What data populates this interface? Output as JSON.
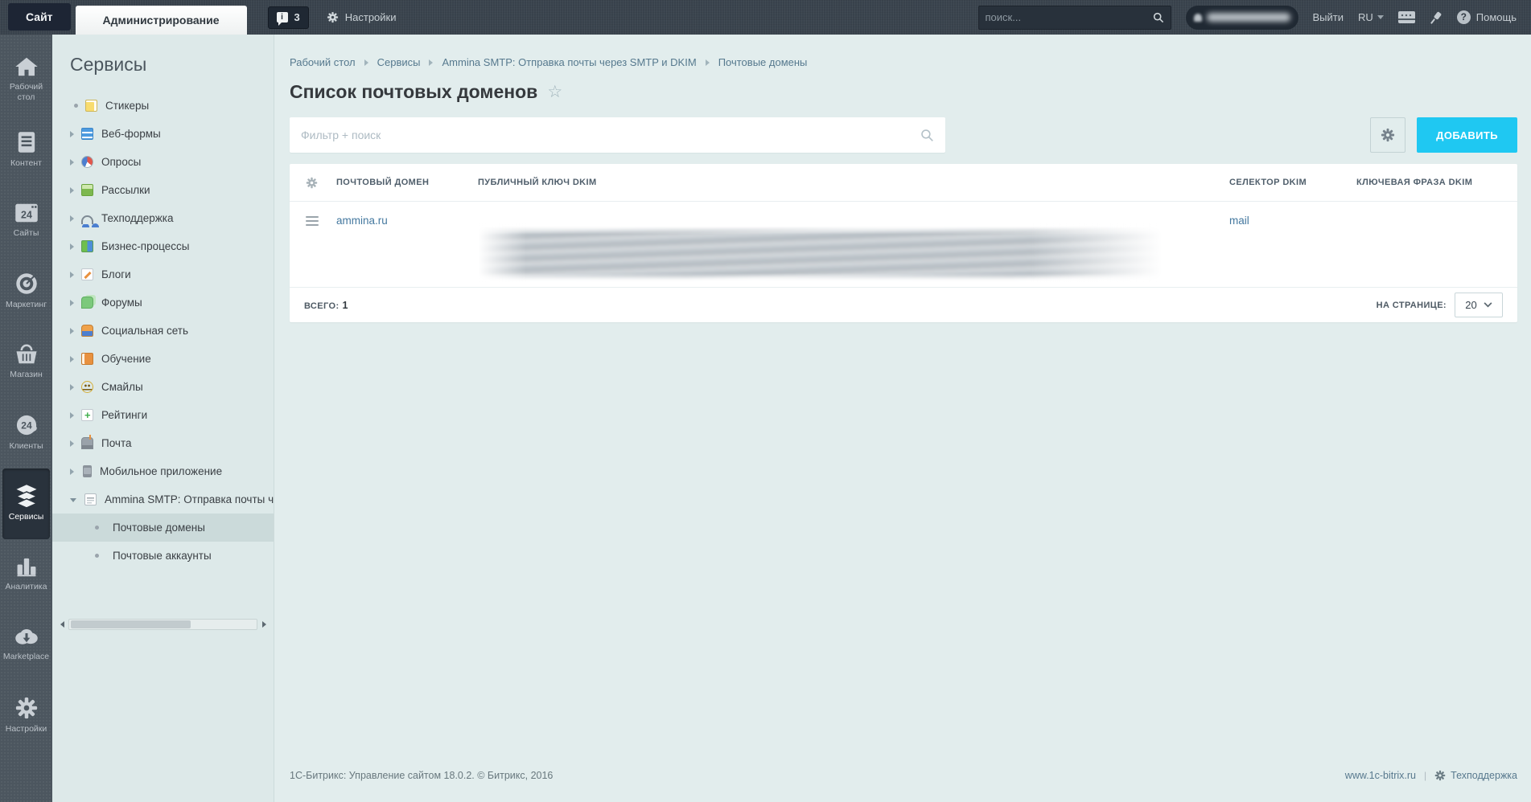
{
  "topbar": {
    "tabs": [
      {
        "label": "Сайт",
        "active": false
      },
      {
        "label": "Администрирование",
        "active": true
      }
    ],
    "notifications_count": "3",
    "settings_label": "Настройки",
    "search_placeholder": "поиск...",
    "logout_label": "Выйти",
    "language": "RU",
    "help_label": "Помощь"
  },
  "sidebar": {
    "items": [
      {
        "label": "Рабочий стол",
        "icon": "home-icon",
        "active": false
      },
      {
        "label": "Контент",
        "icon": "document-icon",
        "active": false
      },
      {
        "label": "Сайты",
        "icon": "sites-24-icon",
        "active": false
      },
      {
        "label": "Маркетинг",
        "icon": "target-icon",
        "active": false
      },
      {
        "label": "Магазин",
        "icon": "basket-icon",
        "active": false
      },
      {
        "label": "Клиенты",
        "icon": "clients-24-icon",
        "active": false
      },
      {
        "label": "Сервисы",
        "icon": "layers-icon",
        "active": true
      },
      {
        "label": "Аналитика",
        "icon": "bar-chart-icon",
        "active": false
      },
      {
        "label": "Marketplace",
        "icon": "cloud-download-icon",
        "active": false
      },
      {
        "label": "Настройки",
        "icon": "gear-icon",
        "active": false
      }
    ]
  },
  "menu": {
    "title": "Сервисы",
    "items": [
      {
        "label": "Стикеры",
        "bullet": "dot",
        "icon": "stickers-icon"
      },
      {
        "label": "Веб-формы",
        "bullet": "arrow",
        "icon": "webforms-icon"
      },
      {
        "label": "Опросы",
        "bullet": "arrow",
        "icon": "polls-icon"
      },
      {
        "label": "Рассылки",
        "bullet": "arrow",
        "icon": "newsletter-icon"
      },
      {
        "label": "Техподдержка",
        "bullet": "arrow",
        "icon": "support-icon"
      },
      {
        "label": "Бизнес-процессы",
        "bullet": "arrow",
        "icon": "bizproc-icon"
      },
      {
        "label": "Блоги",
        "bullet": "arrow",
        "icon": "blog-icon"
      },
      {
        "label": "Форумы",
        "bullet": "arrow",
        "icon": "forum-icon"
      },
      {
        "label": "Социальная сеть",
        "bullet": "arrow",
        "icon": "social-icon"
      },
      {
        "label": "Обучение",
        "bullet": "arrow",
        "icon": "learning-icon"
      },
      {
        "label": "Смайлы",
        "bullet": "arrow",
        "icon": "smiles-icon"
      },
      {
        "label": "Рейтинги",
        "bullet": "arrow",
        "icon": "ratings-icon"
      },
      {
        "label": "Почта",
        "bullet": "arrow",
        "icon": "mailbox-icon"
      },
      {
        "label": "Мобильное приложение",
        "bullet": "arrow",
        "icon": "mobile-icon"
      },
      {
        "label": "Ammina SMTP: Отправка почты ч",
        "bullet": "expanded",
        "icon": "document-icon"
      },
      {
        "label": "Почтовые домены",
        "sub": true,
        "selected": true
      },
      {
        "label": "Почтовые аккаунты",
        "sub": true,
        "selected": false
      }
    ]
  },
  "main": {
    "breadcrumb": [
      {
        "label": "Рабочий стол"
      },
      {
        "label": "Сервисы"
      },
      {
        "label": "Ammina SMTP: Отправка почты через SMTP и DKIM"
      },
      {
        "label": "Почтовые домены"
      }
    ],
    "title": "Список почтовых доменов",
    "filter_placeholder": "Фильтр + поиск",
    "add_button_label": "ДОБАВИТЬ",
    "table": {
      "columns": [
        {
          "label": "ПОЧТОВЫЙ ДОМЕН"
        },
        {
          "label": "ПУБЛИЧНЫЙ КЛЮЧ DKIM"
        },
        {
          "label": "СЕЛЕКТОР DKIM"
        },
        {
          "label": "КЛЮЧЕВАЯ ФРАЗА DKIM"
        }
      ],
      "rows": [
        {
          "domain": "ammina.ru",
          "dkim_key_blurred": true,
          "selector": "mail",
          "key_phrase": ""
        }
      ],
      "total_label": "ВСЕГО:",
      "total_value": "1",
      "per_page_label": "НА СТРАНИЦЕ:",
      "per_page_value": "20"
    }
  },
  "footer": {
    "copyright": "1С-Битрикс: Управление сайтом 18.0.2. © Битрикс, 2016",
    "site_link": "www.1c-bitrix.ru",
    "support_label": "Техподдержка"
  },
  "colors": {
    "topbar_bg": "#3a444e",
    "sidebar_bg": "#4c565f",
    "menu_bg": "#dde9e9",
    "content_bg": "#e2eded",
    "accent_button": "#1fc8f2",
    "link": "#44789f",
    "selected_menu_bg": "#cbdada"
  }
}
